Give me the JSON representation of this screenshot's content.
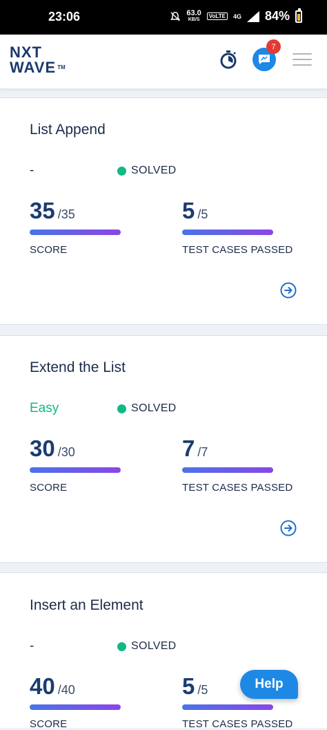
{
  "status_bar": {
    "time": "23:06",
    "speed_value": "63.0",
    "speed_unit": "KB/S",
    "volte": "VoLTE",
    "network": "4G",
    "battery": "84%"
  },
  "header": {
    "logo_line1": "NXT",
    "logo_line2": "WAVE",
    "logo_tm": "TM",
    "notification_count": "7",
    "icons": [
      "stopwatch-icon",
      "chat-icon",
      "menu-icon"
    ]
  },
  "cards": [
    {
      "title": "List Append",
      "difficulty": "-",
      "status": "SOLVED",
      "score": "35",
      "score_total": "/35",
      "score_label": "SCORE",
      "tests": "5",
      "tests_total": "/5",
      "tests_label": "TEST CASES PASSED"
    },
    {
      "title": "Extend the List",
      "difficulty": "Easy",
      "status": "SOLVED",
      "score": "30",
      "score_total": "/30",
      "score_label": "SCORE",
      "tests": "7",
      "tests_total": "/7",
      "tests_label": "TEST CASES PASSED"
    },
    {
      "title": "Insert an Element",
      "difficulty": "-",
      "status": "SOLVED",
      "score": "40",
      "score_total": "/40",
      "score_label": "SCORE",
      "tests": "5",
      "tests_total": "/5",
      "tests_label": "TEST CASES PASSED"
    }
  ],
  "help_label": "Help",
  "colors": {
    "accent": "#1e88e5",
    "solved": "#12b886",
    "easy": "#12b886",
    "heading": "#1c3c70",
    "badge": "#e53935"
  }
}
